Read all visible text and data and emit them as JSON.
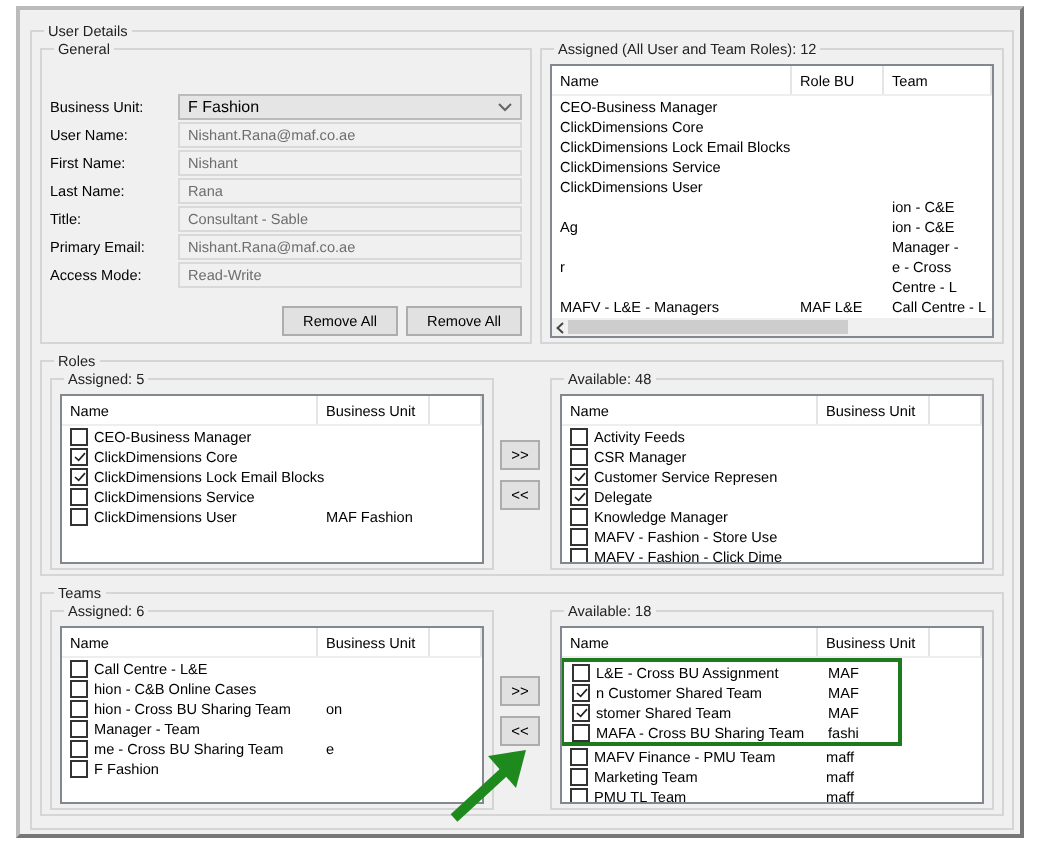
{
  "user_details": {
    "title": "User Details",
    "general": {
      "title": "General",
      "fields": [
        {
          "label": "Business Unit:",
          "value": "F Fashion",
          "kind": "dropdown",
          "disabled": false
        },
        {
          "label": "User Name:",
          "value": "Nishant.Rana@maf.co.ae",
          "kind": "text",
          "disabled": true
        },
        {
          "label": "First Name:",
          "value": "Nishant",
          "kind": "text",
          "disabled": true
        },
        {
          "label": "Last Name:",
          "value": "Rana",
          "kind": "text",
          "disabled": true
        },
        {
          "label": "Title:",
          "value": "Consultant - Sable",
          "kind": "text",
          "disabled": true
        },
        {
          "label": "Primary Email:",
          "value": "Nishant.Rana@maf.co.ae",
          "kind": "text",
          "disabled": true
        },
        {
          "label": "Access Mode:",
          "value": "Read-Write",
          "kind": "text",
          "disabled": true
        }
      ],
      "buttons": [
        "Remove All",
        "Remove All"
      ]
    },
    "all_roles": {
      "title": "Assigned (All User and Team Roles): 12",
      "columns": [
        "Name",
        "Role BU",
        "Team"
      ],
      "rows": [
        {
          "name": "CEO-Business Manager"
        },
        {
          "name": "ClickDimensions Core"
        },
        {
          "name": "ClickDimensions Lock Email Blocks"
        },
        {
          "name": "ClickDimensions Service"
        },
        {
          "name": "ClickDimensions User"
        },
        {
          "team": "ion - C&E"
        },
        {
          "name": "Ag",
          "team": "ion - C&E"
        },
        {
          "team": "Manager -"
        },
        {
          "name": "r",
          "team": "e - Cross"
        },
        {
          "team": "Centre - L"
        },
        {
          "name": "MAFV - L&E - Managers",
          "role_bu": "MAF L&E",
          "team": "Call Centre - L"
        }
      ]
    },
    "roles": {
      "title": "Roles",
      "assigned": {
        "title": "Assigned: 5",
        "columns": [
          "Name",
          "Business Unit"
        ],
        "rows": [
          {
            "name": "CEO-Business Manager",
            "checked": false
          },
          {
            "name": "ClickDimensions Core",
            "checked": true
          },
          {
            "name": "ClickDimensions Lock Email Blocks",
            "checked": true
          },
          {
            "name": "ClickDimensions Service",
            "checked": false
          },
          {
            "name": "ClickDimensions User",
            "checked": false,
            "bu": "MAF Fashion"
          }
        ]
      },
      "move_buttons": [
        ">>",
        "<<"
      ],
      "available": {
        "title": "Available: 48",
        "columns": [
          "Name",
          "Business Unit"
        ],
        "rows": [
          {
            "name": "Activity Feeds",
            "checked": false
          },
          {
            "name": "CSR Manager",
            "checked": false
          },
          {
            "name": "Customer Service Represen",
            "checked": true
          },
          {
            "name": "Delegate",
            "checked": true
          },
          {
            "name": "Knowledge Manager",
            "checked": false
          },
          {
            "name": "MAFV - Fashion -  Store Use",
            "checked": false
          },
          {
            "name": "MAFV - Fashion - Click Dime",
            "checked": false
          }
        ]
      }
    },
    "teams": {
      "title": "Teams",
      "assigned": {
        "title": "Assigned: 6",
        "columns": [
          "Name",
          "Business Unit"
        ],
        "rows": [
          {
            "name": "Call Centre - L&E",
            "checked": false
          },
          {
            "name": "hion - C&B Online Cases",
            "checked": false
          },
          {
            "name": "hion - Cross BU Sharing Team",
            "checked": false,
            "bu": "on"
          },
          {
            "name": "Manager - Team",
            "checked": false
          },
          {
            "name": "me - Cross BU Sharing Team",
            "checked": false,
            "bu": "e"
          },
          {
            "name": "F Fashion",
            "checked": false
          }
        ]
      },
      "move_buttons": [
        ">>",
        "<<"
      ],
      "available": {
        "title": "Available: 18",
        "columns": [
          "Name",
          "Business Unit"
        ],
        "rows": [
          {
            "name": "L&E - Cross BU Assignment",
            "checked": false,
            "bu": "MAF",
            "highlighted": true
          },
          {
            "name": "n Customer Shared Team",
            "checked": true,
            "bu": "MAF",
            "highlighted": true
          },
          {
            "name": "stomer Shared Team",
            "checked": true,
            "bu": "MAF",
            "highlighted": true
          },
          {
            "name": "MAFA - Cross BU Sharing Team",
            "checked": false,
            "bu": "fashi",
            "highlighted": true
          },
          {
            "name": "MAFV Finance - PMU Team",
            "checked": false,
            "bu": "maff",
            "highlighted": false
          },
          {
            "name": "Marketing Team",
            "checked": false,
            "bu": "maff",
            "highlighted": false
          },
          {
            "name": "PMU TL Team",
            "checked": false,
            "bu": "maff",
            "highlighted": false
          }
        ]
      }
    }
  }
}
